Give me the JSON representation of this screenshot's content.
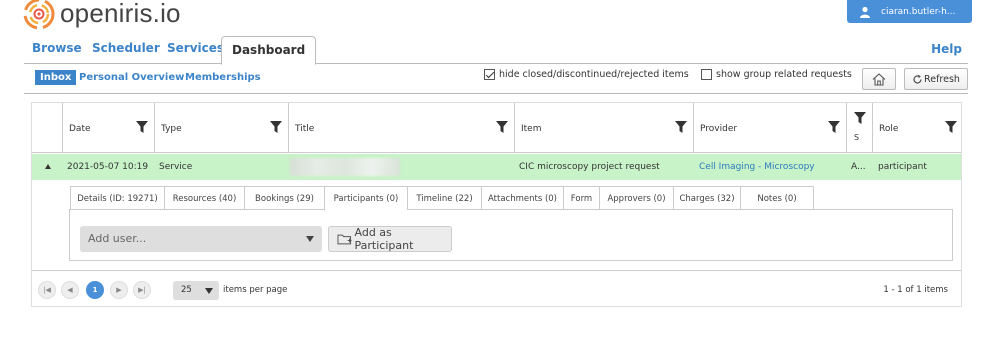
{
  "header": {
    "logo_text": "openiris.io",
    "user_label": "ciaran.butler-h..."
  },
  "main_tabs": [
    {
      "label": "Browse"
    },
    {
      "label": "Scheduler"
    },
    {
      "label": "Services"
    },
    {
      "label": "Dashboard",
      "active": true
    }
  ],
  "help_label": "Help",
  "sub_tabs": [
    {
      "label": "Inbox",
      "active": true
    },
    {
      "label": "Personal Overview"
    },
    {
      "label": "Memberships"
    }
  ],
  "filters": {
    "hide_closed": {
      "label": "hide closed/discontinued/rejected items",
      "checked": true
    },
    "show_group": {
      "label": "show group related requests",
      "checked": false
    }
  },
  "toolbar": {
    "home_icon": "home-icon",
    "refresh_label": "Refresh"
  },
  "grid": {
    "columns": [
      "Date",
      "Type",
      "Title",
      "Item",
      "Provider",
      "S",
      "Role"
    ],
    "rows": [
      {
        "date": "2021-05-07 10:19",
        "type": "Service",
        "title": "",
        "item": "CIC microscopy project request",
        "provider": "Cell Imaging - Microscopy",
        "status": "A...",
        "role": "participant"
      }
    ]
  },
  "detail_tabs": [
    {
      "label": "Details (ID: 19271)"
    },
    {
      "label": "Resources (40)"
    },
    {
      "label": "Bookings (29)"
    },
    {
      "label": "Participants (0)",
      "active": true
    },
    {
      "label": "Timeline (22)"
    },
    {
      "label": "Attachments (0)"
    },
    {
      "label": "Form"
    },
    {
      "label": "Approvers (0)"
    },
    {
      "label": "Charges (32)"
    },
    {
      "label": "Notes (0)"
    }
  ],
  "participants": {
    "add_user_placeholder": "Add user...",
    "add_button": "Add as Participant"
  },
  "pager": {
    "current_page": "1",
    "page_size": "25",
    "page_size_label": "items per page",
    "info": "1 - 1 of 1 items"
  },
  "colors": {
    "accent": "#3c84c9",
    "row_highlight": "#c8f3c8",
    "user_button": "#4a90d9"
  }
}
